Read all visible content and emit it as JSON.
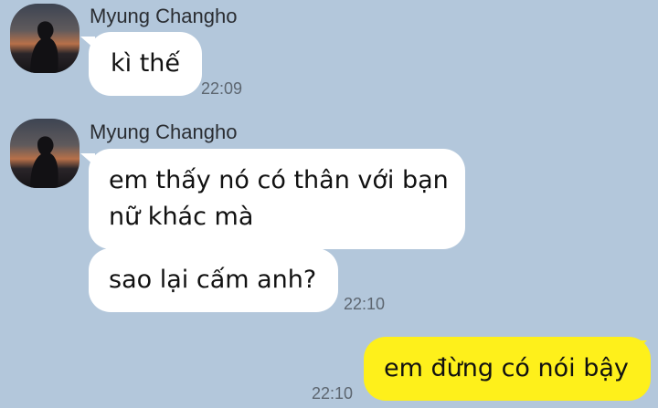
{
  "messages": [
    {
      "sender": "Myung Changho",
      "text": "kì thế",
      "time": "22:09"
    },
    {
      "sender": "Myung Changho",
      "lines": [
        "em thấy nó có thân với bạn",
        "nữ khác mà"
      ]
    },
    {
      "text": "sao lại cấm anh?",
      "time": "22:10"
    },
    {
      "text": "em đừng có nói bậy",
      "time": "22:10",
      "own": true
    }
  ],
  "colors": {
    "background": "#b3c7db",
    "incoming_bubble": "#ffffff",
    "outgoing_bubble": "#fef01b"
  }
}
